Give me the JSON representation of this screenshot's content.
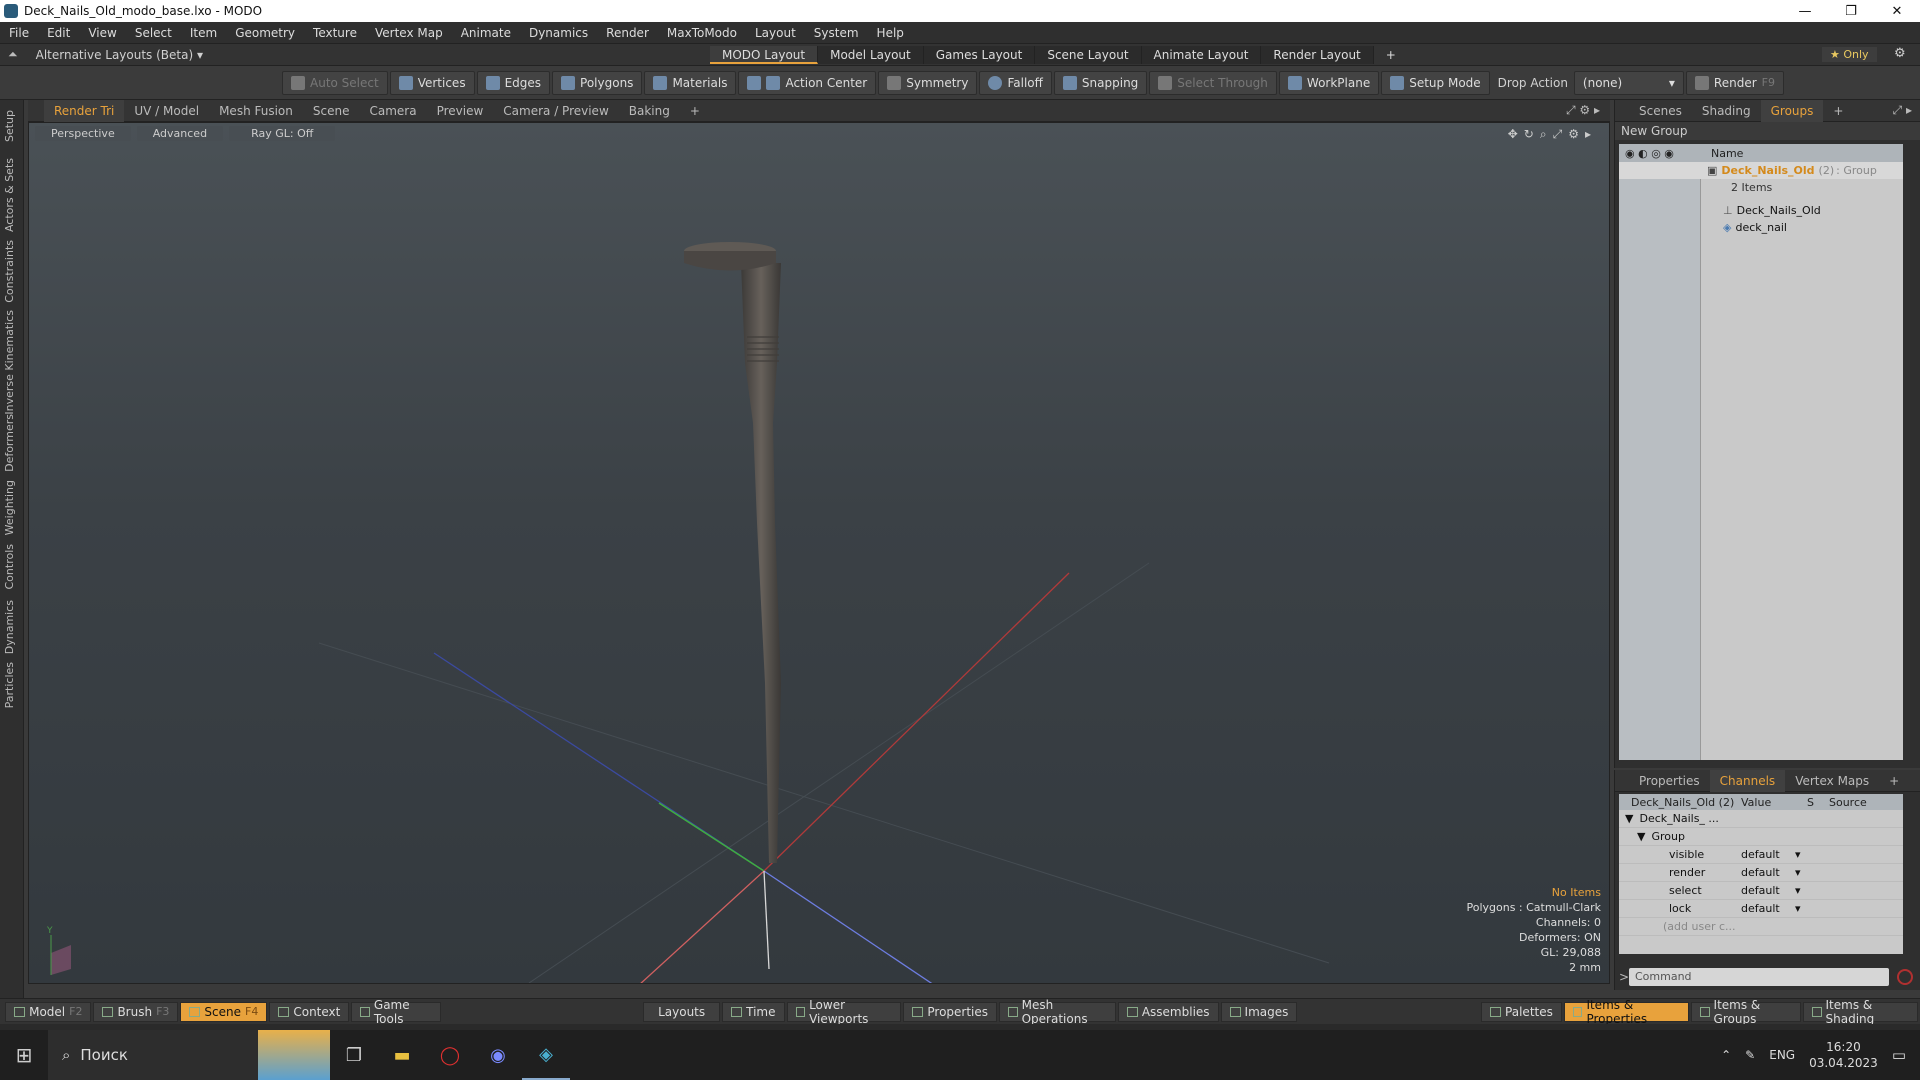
{
  "window": {
    "title": "Deck_Nails_Old_modo_base.lxo - MODO",
    "minimize": "—",
    "maximize": "❐",
    "close": "✕"
  },
  "menu": [
    "File",
    "Edit",
    "View",
    "Select",
    "Item",
    "Geometry",
    "Texture",
    "Vertex Map",
    "Animate",
    "Dynamics",
    "Render",
    "MaxToModo",
    "Layout",
    "System",
    "Help"
  ],
  "layoutbar": {
    "alt_layouts": "Alternative Layouts (Beta) ▾",
    "tabs": [
      "MODO Layout",
      "Model Layout",
      "Games Layout",
      "Scene Layout",
      "Animate Layout",
      "Render Layout"
    ],
    "add": "+",
    "only": "★ Only",
    "gear": "⚙"
  },
  "toolbar": {
    "auto_select": "Auto Select",
    "vertices": "Vertices",
    "edges": "Edges",
    "polygons": "Polygons",
    "materials": "Materials",
    "action_center": "Action Center",
    "symmetry": "Symmetry",
    "falloff": "Falloff",
    "snapping": "Snapping",
    "select_through": "Select Through",
    "workplane": "WorkPlane",
    "setup_mode": "Setup Mode",
    "drop_action": "Drop Action",
    "drop_value": "(none)",
    "render": "Render",
    "render_key": "F9"
  },
  "left_tabs": [
    "Setup",
    "Actors & Sets",
    "Constraints",
    "Inverse Kinematics",
    "Deformers",
    "Weighting",
    "Controls",
    "Dynamics",
    "Particles"
  ],
  "viewport_tabs": [
    "Render Tri",
    "UV / Model",
    "Mesh Fusion",
    "Scene",
    "Camera",
    "Preview",
    "Camera / Preview",
    "Baking"
  ],
  "viewport": {
    "view": "Perspective",
    "advanced": "Advanced",
    "raygl": "Ray GL: Off",
    "hud": {
      "items": "No Items",
      "polygons": "Polygons : Catmull-Clark",
      "channels": "Channels: 0",
      "deformers": "Deformers: ON",
      "gl": "GL: 29,088",
      "scale": "2 mm"
    },
    "axis_label": "Y"
  },
  "right_tabs": [
    "Scenes",
    "Shading",
    "Groups"
  ],
  "groups": {
    "new_group": "New Group",
    "name_header": "Name",
    "root": "Deck_Nails_Old",
    "root_count": "(2)",
    "root_type": ": Group",
    "items_count": "2 Items",
    "children": [
      "Deck_Nails_Old",
      "deck_nail"
    ]
  },
  "channel_tabs": [
    "Properties",
    "Channels",
    "Vertex Maps"
  ],
  "channels": {
    "header": {
      "name": "Deck_Nails_Old (2)",
      "value": "Value",
      "s": "S",
      "source": "Source"
    },
    "tree_root": "Deck_Nails_ ...",
    "group": "Group",
    "rows": [
      {
        "name": "visible",
        "value": "default"
      },
      {
        "name": "render",
        "value": "default"
      },
      {
        "name": "select",
        "value": "default"
      },
      {
        "name": "lock",
        "value": "default"
      }
    ],
    "add_user": "(add user c...",
    "command_placeholder": "Command"
  },
  "bottombar": {
    "model": "Model",
    "model_key": "F2",
    "brush": "Brush",
    "brush_key": "F3",
    "scene": "Scene",
    "scene_key": "F4",
    "context": "Context",
    "game_tools": "Game Tools",
    "layouts": "Layouts",
    "time": "Time",
    "lower_viewports": "Lower Viewports",
    "properties": "Properties",
    "mesh_operations": "Mesh Operations",
    "assemblies": "Assemblies",
    "images": "Images",
    "palettes": "Palettes",
    "items_properties": "Items & Properties",
    "items_groups": "Items & Groups",
    "items_shading": "Items & Shading"
  },
  "taskbar": {
    "search": "Поиск",
    "lang": "ENG",
    "time": "16:20",
    "date": "03.04.2023"
  },
  "colors": {
    "accent": "#e8a23c",
    "panel": "#2f2f2f"
  }
}
